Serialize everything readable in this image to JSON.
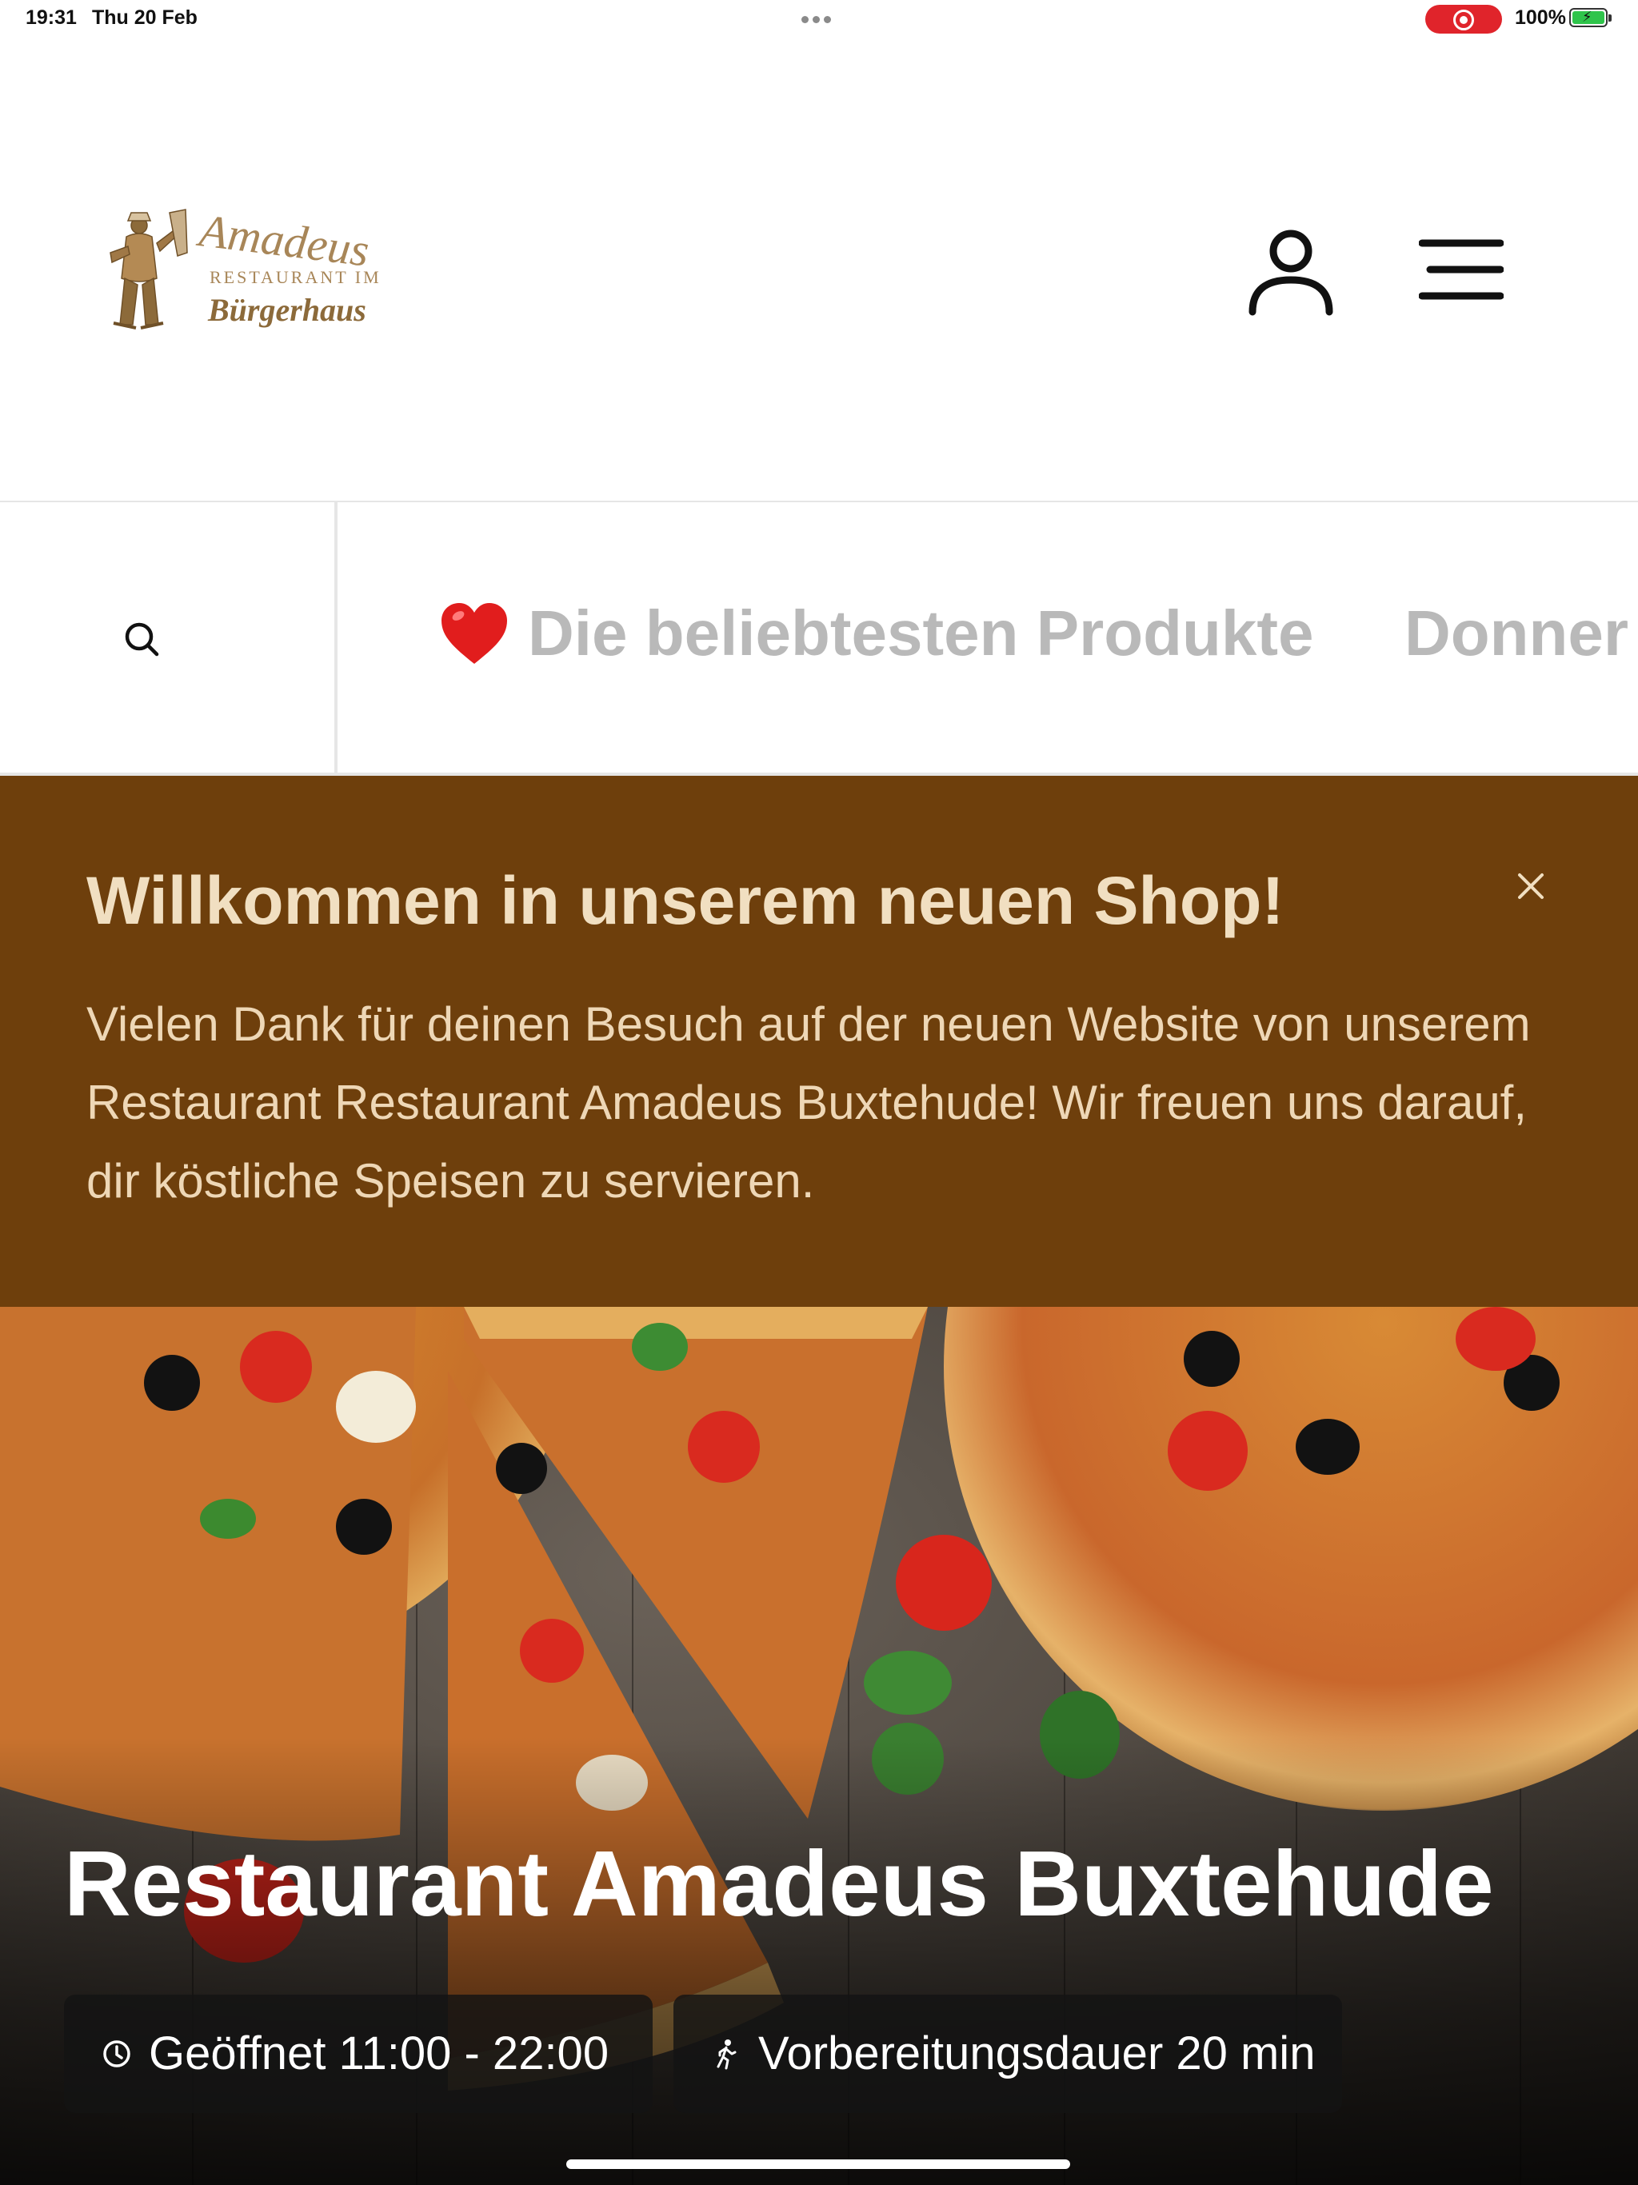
{
  "status_bar": {
    "time": "19:31",
    "date": "Thu 20 Feb",
    "battery": "100%"
  },
  "header": {
    "logo_line_1": "Amadeus",
    "logo_line_2": "RESTAURANT IM",
    "logo_line_3": "Bürgerhaus"
  },
  "categories": {
    "items": [
      {
        "emoji": "❤️",
        "label": "Die beliebtesten Produkte"
      },
      {
        "label": "Donner"
      }
    ]
  },
  "banner": {
    "title": "Willkommen in unserem neuen Shop!",
    "text": "Vielen Dank für deinen Besuch auf der neuen Website von unserem Restaurant Restaurant Amadeus Buxtehude! Wir freuen uns darauf, dir köstliche Speisen zu servieren."
  },
  "hero": {
    "title": "Restaurant Amadeus Buxtehude",
    "opening_hours": "Geöffnet 11:00 - 22:00",
    "prep_time": "Vorbereitungsdauer 20 min"
  },
  "colors": {
    "banner_bg": "#6e3f0c",
    "banner_title": "#f1dfc1",
    "category_text": "#b9b9b9",
    "recording_pill": "#e0242b"
  }
}
